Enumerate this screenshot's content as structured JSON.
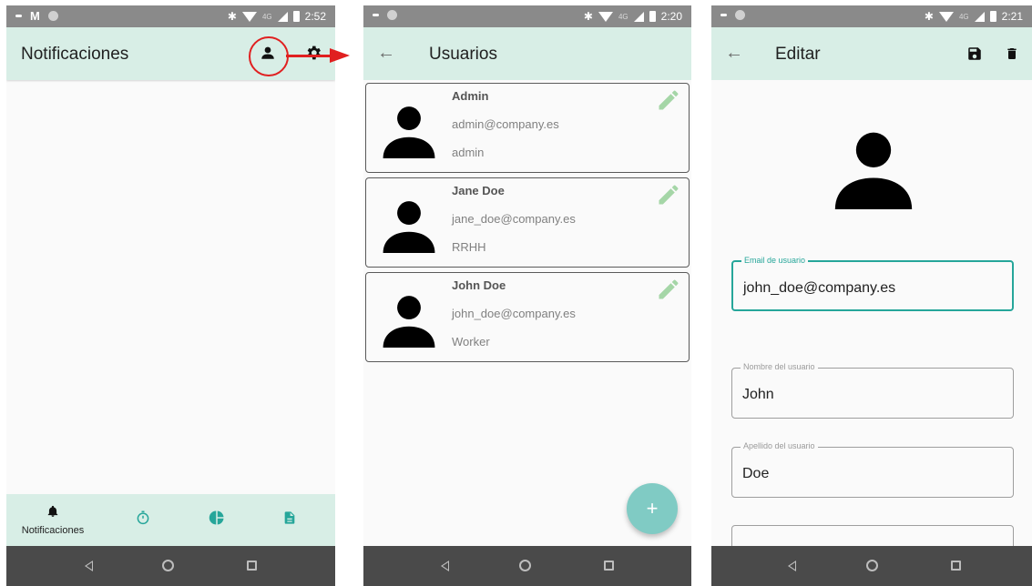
{
  "screens": [
    {
      "status": {
        "time": "2:52"
      },
      "appbar": {
        "title": "Notificaciones",
        "icons": [
          "person-icon",
          "gear-icon"
        ]
      },
      "bottom_nav": {
        "items": [
          {
            "label": "Notificaciones",
            "icon": "bell-icon",
            "selected": true
          },
          {
            "label": "",
            "icon": "timer-icon"
          },
          {
            "label": "",
            "icon": "pie-chart-icon"
          },
          {
            "label": "",
            "icon": "document-icon"
          }
        ]
      }
    },
    {
      "status": {
        "time": "2:20"
      },
      "appbar": {
        "title": "Usuarios",
        "back_icon": "back-arrow-icon"
      },
      "users": [
        {
          "name": "Admin",
          "email": "admin@company.es",
          "role": "admin"
        },
        {
          "name": "Jane Doe",
          "email": "jane_doe@company.es",
          "role": "RRHH"
        },
        {
          "name": "John Doe",
          "email": "john_doe@company.es",
          "role": "Worker"
        }
      ],
      "fab": {
        "label": "+"
      }
    },
    {
      "status": {
        "time": "2:21"
      },
      "appbar": {
        "title": "Editar",
        "icons": [
          "save-icon",
          "trash-icon"
        ]
      },
      "fields": [
        {
          "label": "Email de usuario",
          "value": "john_doe@company.es",
          "focused": true
        },
        {
          "label": "Nombre del usuario",
          "value": "John"
        },
        {
          "label": "Apellido del usuario",
          "value": "Doe"
        },
        {
          "label": "",
          "value": ""
        }
      ]
    }
  ],
  "colors": {
    "appbar": "#d8eee6",
    "status_bar": "#8a8a8a",
    "system_nav": "#4a4a4a",
    "accent": "#26a69a",
    "fab": "#80cbc4",
    "annotation": "#e02020"
  },
  "annotation": {
    "icons": [
      "highlight-circle",
      "right-arrow-icon"
    ]
  }
}
